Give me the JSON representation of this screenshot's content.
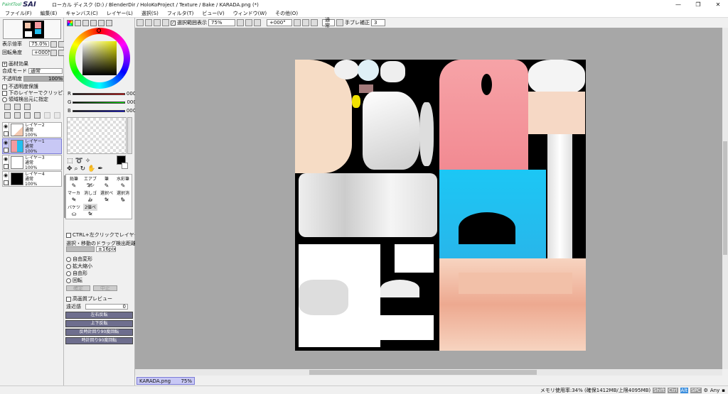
{
  "app": {
    "logo_small": "PaintTool",
    "logo_big": "SAI",
    "title": "ローカル ディスク (D:) / BlenderDir / HoloKoProject / Texture / Bake / KARADA.png (*)"
  },
  "menu": [
    "ファイル(F)",
    "編集(E)",
    "キャンバス(C)",
    "レイヤー(L)",
    "選択(S)",
    "フィルタ(T)",
    "ビュー(V)",
    "ウィンドウ(W)",
    "その他(O)"
  ],
  "toolbar": {
    "show_selection_label": "選択範囲表示",
    "zoom": "75%",
    "angle": "+000°",
    "mode": "通常",
    "stabilizer_label": "手ブレ補正",
    "stabilizer_value": "3"
  },
  "navigator": {
    "zoom_label": "表示倍率",
    "zoom_value": "75.0%",
    "angle_label": "回転角度",
    "angle_value": "+000°"
  },
  "layer_panel": {
    "effects_label": "画材効果",
    "blend_label": "合成モード",
    "blend_value": "通常",
    "opacity_label": "不透明度",
    "opacity_value": "100%",
    "checks": [
      "不透明度保護",
      "下のレイヤーでクリッピング",
      "領域検出元に指定"
    ],
    "layers": [
      {
        "name": "レイヤー2",
        "mode": "通常",
        "opacity": "100%"
      },
      {
        "name": "レイヤー1",
        "mode": "通常",
        "opacity": "100%"
      },
      {
        "name": "レイヤー3",
        "mode": "通常",
        "opacity": "100%"
      },
      {
        "name": "レイヤー4",
        "mode": "通常",
        "opacity": "100%"
      }
    ]
  },
  "color": {
    "r_label": "R",
    "g_label": "G",
    "b_label": "B",
    "r": "000",
    "g": "000",
    "b": "000"
  },
  "tools": {
    "groups_row1": [
      "鉛筆",
      "エアブラシ",
      "筆",
      "水彩筆"
    ],
    "groups_row2": [
      "マーカー",
      "消しゴム",
      "選択ペン",
      "選択消し"
    ],
    "groups_row3": [
      "バケツ",
      "2値ペン"
    ],
    "ctrl_label": "CTRL+左クリックでレイヤー選択",
    "drag_label": "選択・移動のドラッグ検出距離",
    "drag_value": "±16pix",
    "options": [
      "自由変形",
      "拡大縮小",
      "自由形",
      "回転"
    ],
    "ok": "確定",
    "cancel": "中止",
    "hq_preview": "高画質プレビュー",
    "perspective_label": "遠近感",
    "perspective_value": "0",
    "buttons": [
      "左右反転",
      "上下反転",
      "反時計回り90度回転",
      "時計回り90度回転"
    ]
  },
  "tab": {
    "name": "KARADA.png",
    "zoom": "75%"
  },
  "status": {
    "memory": "メモリ使用率:34% (確保1412MB/上限4095MB)",
    "keys": [
      "Shift",
      "Ctrl",
      "Alt",
      "SPC"
    ],
    "extra": "Any"
  },
  "colors": {
    "accent": "#7b7bd6",
    "canvas_bg": "#a7a7a7"
  }
}
